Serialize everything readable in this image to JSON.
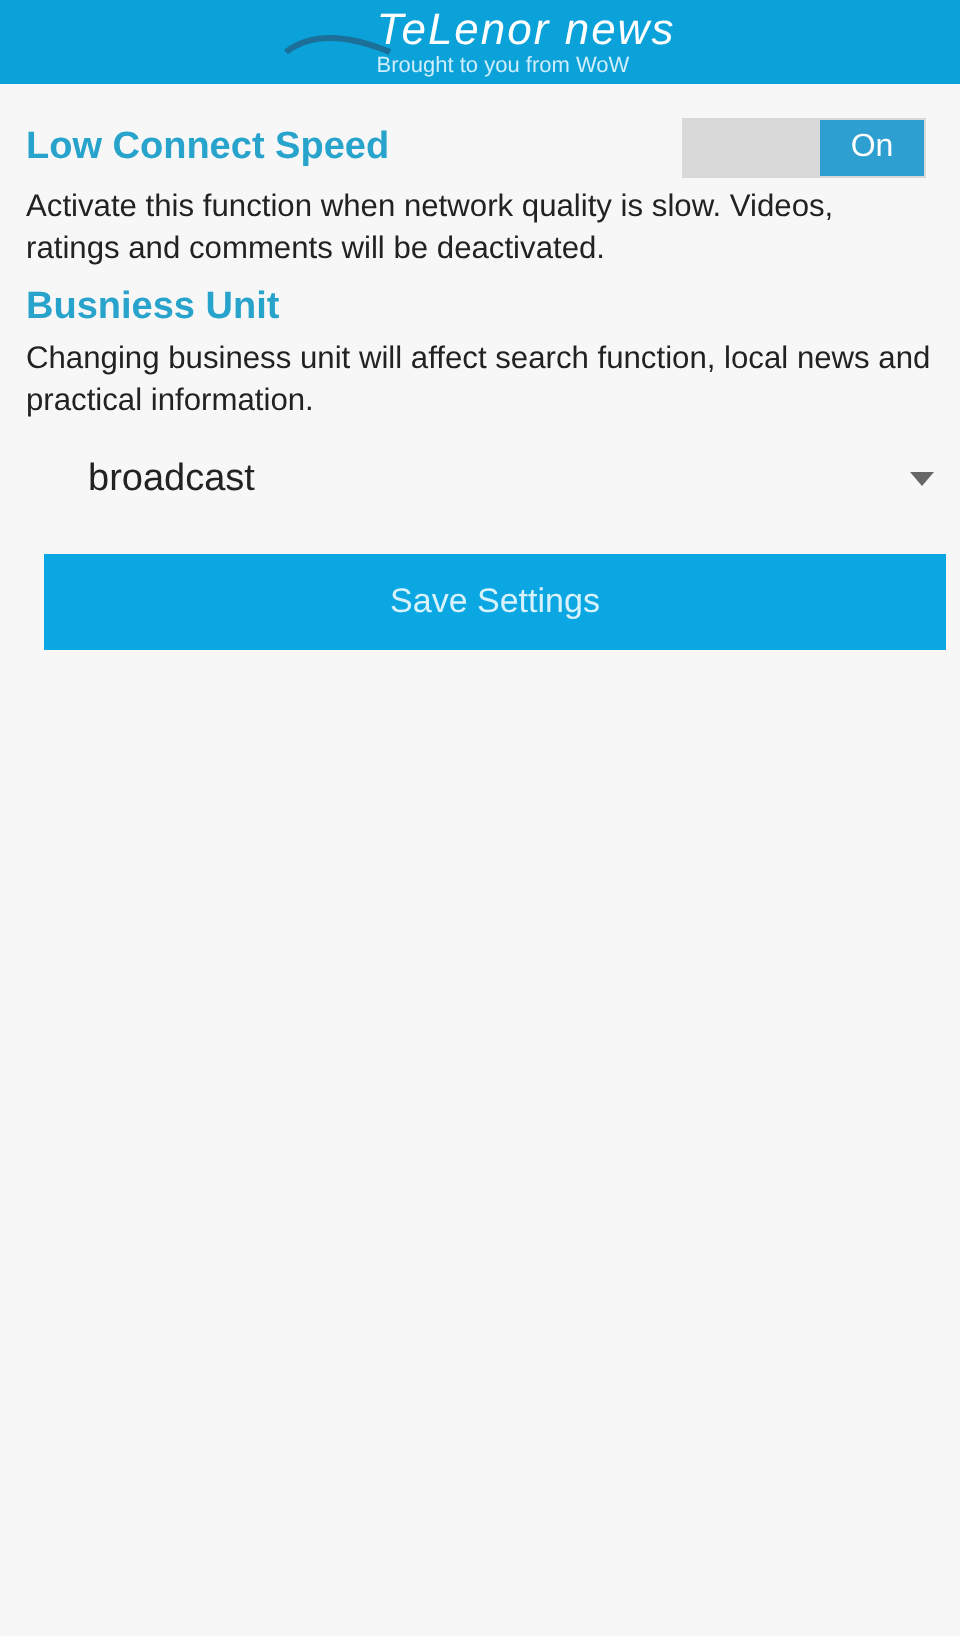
{
  "header": {
    "title": "TeLenor news",
    "subtitle": "Brought to you from WoW"
  },
  "low_connect": {
    "title": "Low Connect Speed",
    "toggle": {
      "label": "On",
      "on": true
    },
    "description": "Activate this function when network quality is slow. Videos, ratings and comments will be deactivated."
  },
  "business_unit": {
    "title": "Busniess Unit",
    "description": "Changing business unit will affect search function, local news and practical information.",
    "value": "broadcast"
  },
  "save_button": "Save Settings"
}
